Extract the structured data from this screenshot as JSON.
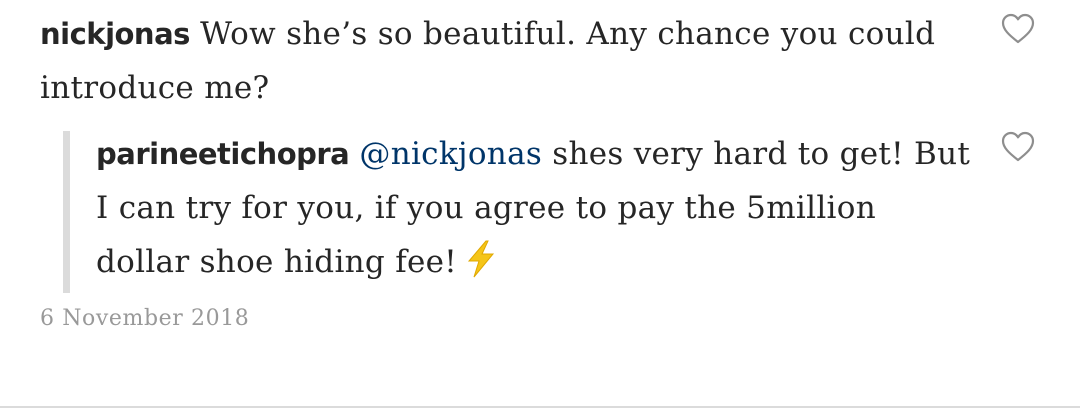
{
  "comments": [
    {
      "username": "nickjonas",
      "text": "Wow she’s so beautiful. Any chance you could introduce me?"
    },
    {
      "username": "parineetichopra",
      "mention": "@nickjonas",
      "text": "shes very hard to get! But I can try for you, if you agree to pay the 5million dollar shoe hiding fee!",
      "emoji": "high-voltage-lightning-emoji"
    }
  ],
  "timestamp": "6 November 2018",
  "icons": {
    "like": "heart-outline-icon"
  },
  "colors": {
    "text": "#262626",
    "mention": "#003569",
    "timestamp": "#999999",
    "reply_bar": "#dbdbdb",
    "lightning": "#f5c518"
  }
}
